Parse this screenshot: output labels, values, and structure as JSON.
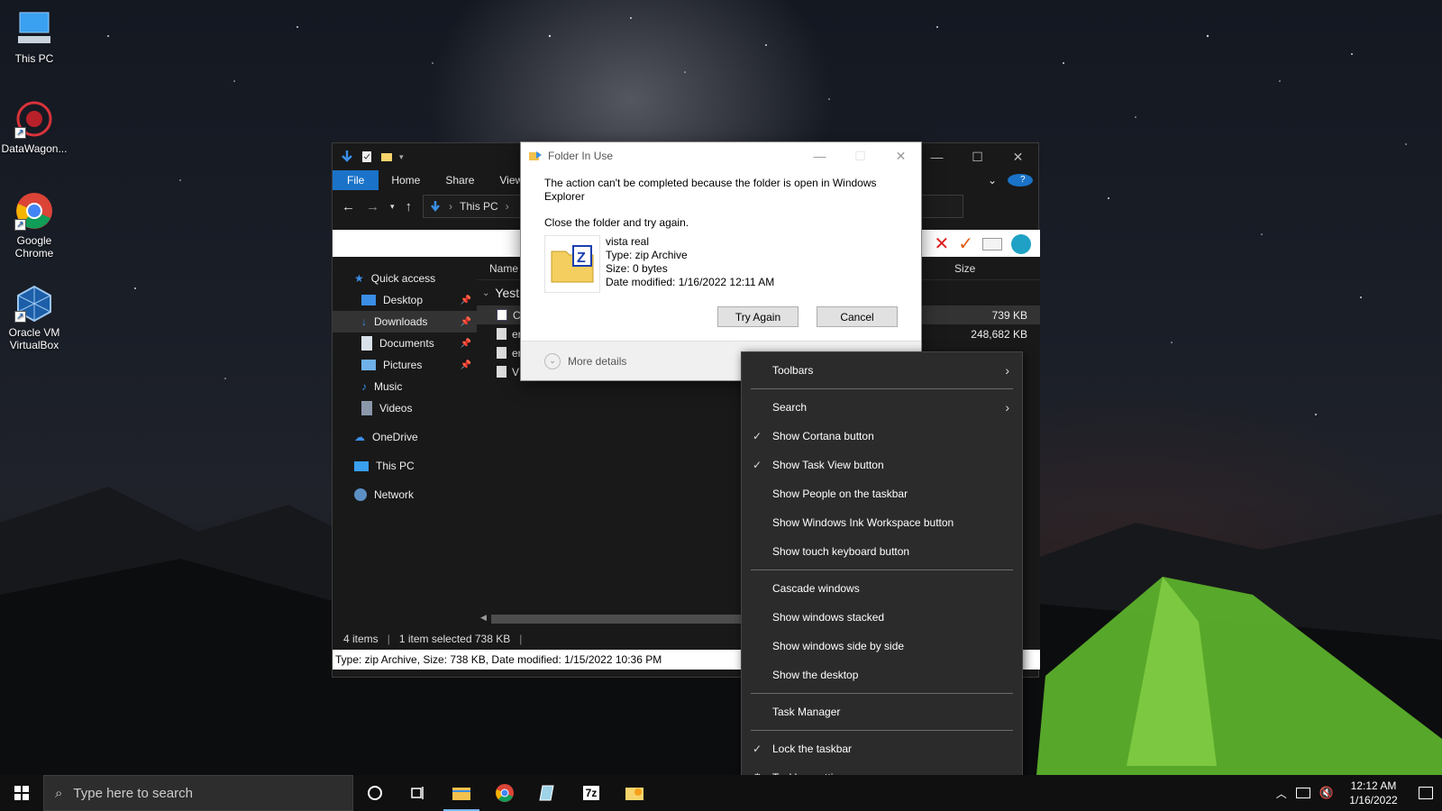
{
  "desktop": {
    "icons": [
      {
        "label": "This PC"
      },
      {
        "label": "DataWagon..."
      },
      {
        "label": "Google Chrome"
      },
      {
        "label": "Oracle VM VirtualBox"
      }
    ]
  },
  "explorer": {
    "tabs": [
      "File",
      "Home",
      "Share",
      "View"
    ],
    "breadcrumb": "This PC",
    "nav": {
      "quick_access": "Quick access",
      "desktop": "Desktop",
      "downloads": "Downloads",
      "documents": "Documents",
      "pictures": "Pictures",
      "music": "Music",
      "videos": "Videos",
      "onedrive": "OneDrive",
      "this_pc": "This PC",
      "network": "Network"
    },
    "columns": {
      "name": "Name",
      "size": "Size"
    },
    "group_label": "Yest",
    "files": [
      {
        "name": "C",
        "size": "739 KB"
      },
      {
        "name": "er",
        "size": "248,682 KB"
      },
      {
        "name": "er",
        "size": ""
      },
      {
        "name": "VI",
        "size": ""
      }
    ],
    "status": {
      "items": "4 items",
      "selected": "1 item selected  738 KB"
    },
    "info_bar": "Type: zip Archive, Size: 738 KB, Date modified: 1/15/2022 10:36 PM"
  },
  "dialog": {
    "title": "Folder In Use",
    "message": "The action can't be completed because the folder is open in Windows Explorer",
    "instruction": "Close the folder and try again.",
    "file": {
      "name": "vista real",
      "type": "Type: zip Archive",
      "size": "Size: 0 bytes",
      "modified": "Date modified: 1/16/2022 12:11 AM"
    },
    "try_again": "Try Again",
    "cancel": "Cancel",
    "more_details": "More details"
  },
  "context_menu": {
    "toolbars": "Toolbars",
    "search": "Search",
    "show_cortana": "Show Cortana button",
    "show_task_view": "Show Task View button",
    "show_people": "Show People on the taskbar",
    "show_ink": "Show Windows Ink Workspace button",
    "show_touch_kb": "Show touch keyboard button",
    "cascade": "Cascade windows",
    "stacked": "Show windows stacked",
    "side_by_side": "Show windows side by side",
    "show_desktop": "Show the desktop",
    "task_manager": "Task Manager",
    "lock_taskbar": "Lock the taskbar",
    "taskbar_settings": "Taskbar settings",
    "checked": [
      "Show Cortana button",
      "Show Task View button",
      "Lock the taskbar"
    ]
  },
  "taskbar": {
    "search_placeholder": "Type here to search",
    "time": "12:12 AM",
    "date": "1/16/2022"
  },
  "colors": {
    "accent": "#1a73c8",
    "menu_bg": "#2b2b2b",
    "taskbar_bg": "#101010"
  }
}
